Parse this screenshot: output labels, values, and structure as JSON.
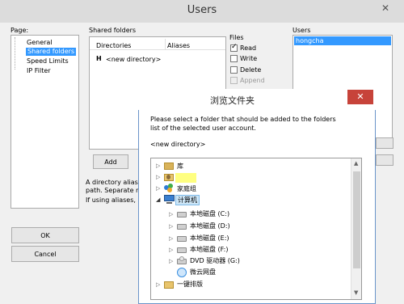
{
  "users_window": {
    "title": "Users",
    "close_glyph": "✕",
    "page": {
      "label": "Page:",
      "items": [
        {
          "label": "General"
        },
        {
          "label": "Shared folders",
          "selected": true
        },
        {
          "label": "Speed Limits"
        },
        {
          "label": "IP Filter"
        }
      ]
    },
    "shared_folders": {
      "label": "Shared folders",
      "columns": [
        "Directories",
        "Aliases"
      ],
      "rows": [
        {
          "marker": "H",
          "directory": "<new directory>",
          "alias": ""
        }
      ],
      "add_label": "Add"
    },
    "files": {
      "label": "Files",
      "options": [
        {
          "label": "Read",
          "checked": true,
          "disabled": false
        },
        {
          "label": "Write",
          "checked": false,
          "disabled": false
        },
        {
          "label": "Delete",
          "checked": false,
          "disabled": false
        },
        {
          "label": "Append",
          "checked": false,
          "disabled": true
        }
      ]
    },
    "users": {
      "label": "Users",
      "items": [
        {
          "label": "hongcha",
          "selected": true
        }
      ]
    },
    "hint_lines": [
      "A directory alias wi",
      "path. Separate mul",
      "If using aliases, ple"
    ],
    "ok_label": "OK",
    "cancel_label": "Cancel"
  },
  "browse_dialog": {
    "title": "浏览文件夹",
    "close_glyph": "✕",
    "instruction_line1": "Please select a folder that should be added to the folders",
    "instruction_line2": "list of the selected user account.",
    "current_path": "<new directory>",
    "tree": [
      {
        "label": "库",
        "icon": "library-icon",
        "expander": "▷"
      },
      {
        "label": "",
        "icon": "user-folder-icon",
        "expander": "▷",
        "highlight": "#ffff80"
      },
      {
        "label": "家庭组",
        "icon": "homegroup-icon",
        "expander": "▷"
      },
      {
        "label": "计算机",
        "icon": "computer-icon",
        "expander": "◢",
        "selected": true
      },
      {
        "label": "本地磁盘 (C:)",
        "icon": "drive-icon",
        "expander": "▷",
        "child": true
      },
      {
        "label": "本地磁盘 (D:)",
        "icon": "drive-icon",
        "expander": "▷",
        "child": true
      },
      {
        "label": "本地磁盘 (E:)",
        "icon": "drive-icon",
        "expander": "▷",
        "child": true
      },
      {
        "label": "本地磁盘 (F:)",
        "icon": "drive-icon",
        "expander": "▷",
        "child": true
      },
      {
        "label": "DVD 驱动器 (G:)",
        "icon": "dvd-drive-icon",
        "expander": "▷",
        "child": true
      },
      {
        "label": "微云网盘",
        "icon": "cloud-drive-icon",
        "expander": "",
        "child": true
      },
      {
        "label": "一键排版",
        "icon": "folder-icon",
        "expander": "▷"
      }
    ]
  }
}
